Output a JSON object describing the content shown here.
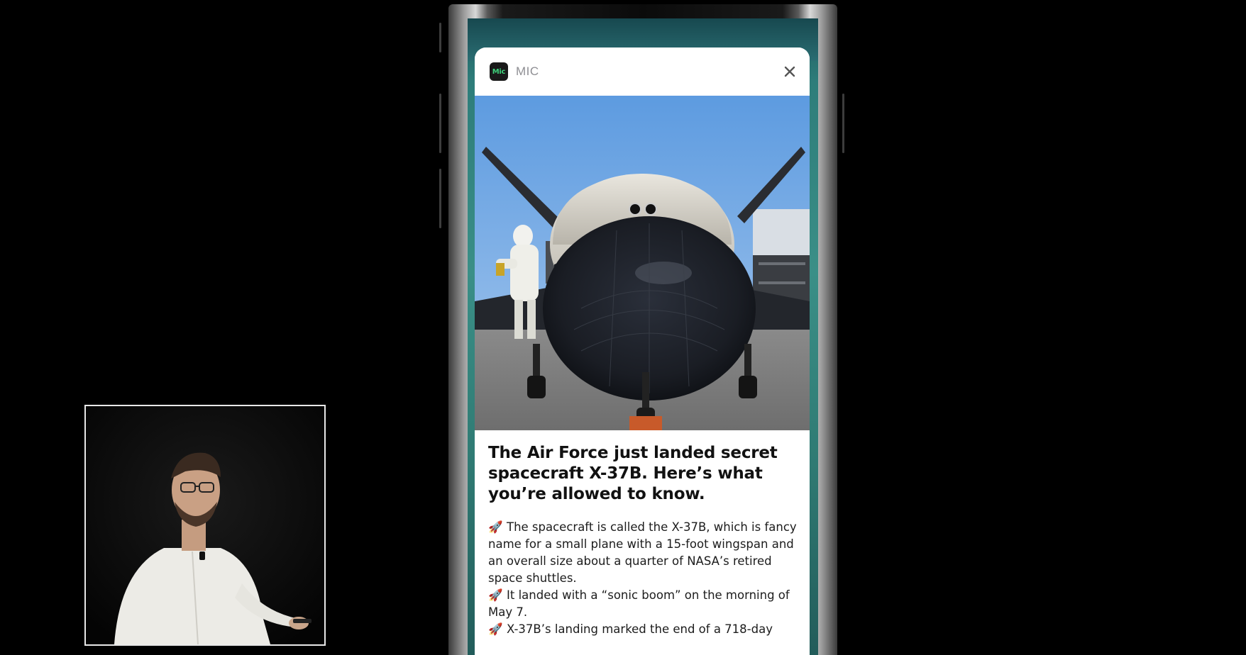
{
  "notification": {
    "app_name": "MIC",
    "app_icon_text": "Mic",
    "app_icon_color": "#3ed07a",
    "close_icon": "close-icon",
    "headline": "The Air Force just landed secret spacecraft X-37B. Here’s what you’re allowed to know.",
    "bullets": [
      {
        "emoji": "🚀",
        "text": "The spacecraft is called the X-37B, which is fancy name for a small plane with a 15-foot wingspan and an overall size about a quarter of NASA’s retired space shuttles."
      },
      {
        "emoji": "🚀",
        "text": "It landed with a “sonic boom” on the morning of May 7."
      },
      {
        "emoji": "🚀",
        "text": "X-37B’s landing marked the end of a 718-day"
      }
    ]
  },
  "colors": {
    "background": "#000000",
    "card": "#ffffff",
    "wallpaper_accent": "#2e7d7a",
    "headline_text": "#111111",
    "app_name_text": "#8e8e93"
  }
}
